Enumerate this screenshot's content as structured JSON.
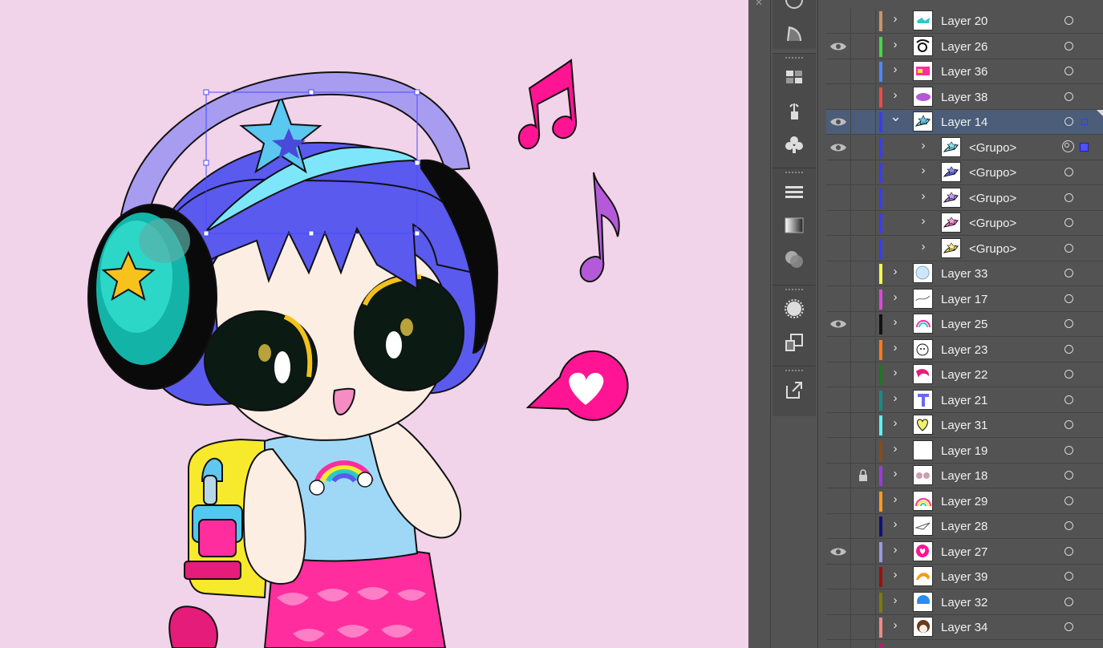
{
  "app": {
    "panel": "Layers"
  },
  "toolbar": {
    "icons": [
      "globe-icon",
      "shaper-icon",
      "swatches-icon",
      "symbol-sprayer-icon",
      "club-symbol-icon",
      "stroke-icon",
      "gradient-icon",
      "transparency-icon",
      "appearance-icon",
      "artboards-icon",
      "export-icon"
    ]
  },
  "layers": [
    {
      "name": "Layer 20",
      "color": "#c9946a",
      "visible": false,
      "locked": false,
      "expanded": false,
      "indent": 0,
      "thumb": "teal-star"
    },
    {
      "name": "Layer 26",
      "color": "#43d843",
      "visible": true,
      "locked": false,
      "expanded": false,
      "indent": 0,
      "thumb": "face"
    },
    {
      "name": "Layer 36",
      "color": "#4e86ff",
      "visible": false,
      "locked": false,
      "expanded": false,
      "indent": 0,
      "thumb": "pink-ticket"
    },
    {
      "name": "Layer 38",
      "color": "#ef4a4a",
      "visible": false,
      "locked": false,
      "expanded": false,
      "indent": 0,
      "thumb": "purple-blob"
    },
    {
      "name": "Layer 14",
      "color": "#3b3bf0",
      "visible": true,
      "locked": false,
      "expanded": true,
      "indent": 0,
      "selected": true,
      "thumb": "tiara"
    },
    {
      "name": "<Grupo>",
      "color": "#3b3bf0",
      "visible": true,
      "locked": false,
      "expanded": false,
      "indent": 1,
      "thumb": "tiara-teal",
      "targeted": true
    },
    {
      "name": "<Grupo>",
      "color": "#3b3bf0",
      "visible": false,
      "locked": false,
      "expanded": false,
      "indent": 1,
      "thumb": "tiara-blue"
    },
    {
      "name": "<Grupo>",
      "color": "#3b3bf0",
      "visible": false,
      "locked": false,
      "expanded": false,
      "indent": 1,
      "thumb": "tiara-purple"
    },
    {
      "name": "<Grupo>",
      "color": "#3b3bf0",
      "visible": false,
      "locked": false,
      "expanded": false,
      "indent": 1,
      "thumb": "tiara-pink"
    },
    {
      "name": "<Grupo>",
      "color": "#3b3bf0",
      "visible": false,
      "locked": false,
      "expanded": false,
      "indent": 1,
      "thumb": "tiara-yellow"
    },
    {
      "name": "Layer 33",
      "color": "#f6f64a",
      "visible": false,
      "locked": false,
      "expanded": false,
      "indent": 0,
      "thumb": "bubble"
    },
    {
      "name": "Layer 17",
      "color": "#e046e0",
      "visible": false,
      "locked": false,
      "expanded": false,
      "indent": 0,
      "thumb": "sketch"
    },
    {
      "name": "Layer 25",
      "color": "#111111",
      "visible": true,
      "locked": false,
      "expanded": false,
      "indent": 0,
      "thumb": "rainbow-sketch"
    },
    {
      "name": "Layer 23",
      "color": "#ff7a1a",
      "visible": false,
      "locked": false,
      "expanded": false,
      "indent": 0,
      "thumb": "bear"
    },
    {
      "name": "Layer 22",
      "color": "#1a7a1a",
      "visible": false,
      "locked": false,
      "expanded": false,
      "indent": 0,
      "thumb": "pink-hair"
    },
    {
      "name": "Layer 21",
      "color": "#178a8a",
      "visible": false,
      "locked": false,
      "expanded": false,
      "indent": 0,
      "thumb": "letter-t"
    },
    {
      "name": "Layer 31",
      "color": "#5cf2f2",
      "visible": false,
      "locked": false,
      "expanded": false,
      "indent": 0,
      "thumb": "yellow-heart"
    },
    {
      "name": "Layer 19",
      "color": "#8a4a1a",
      "visible": false,
      "locked": false,
      "expanded": false,
      "indent": 0,
      "thumb": "blank"
    },
    {
      "name": "Layer 18",
      "color": "#9a3ad6",
      "visible": false,
      "locked": true,
      "expanded": false,
      "indent": 0,
      "thumb": "glasses"
    },
    {
      "name": "Layer 29",
      "color": "#ff9a1a",
      "visible": false,
      "locked": false,
      "expanded": false,
      "indent": 0,
      "thumb": "rainbow"
    },
    {
      "name": "Layer 28",
      "color": "#10107a",
      "visible": false,
      "locked": false,
      "expanded": false,
      "indent": 0,
      "thumb": "plane-sketch"
    },
    {
      "name": "Layer 27",
      "color": "#9a9adf",
      "visible": true,
      "locked": false,
      "expanded": false,
      "indent": 0,
      "thumb": "pink-heart"
    },
    {
      "name": "Layer 39",
      "color": "#9a1010",
      "visible": false,
      "locked": false,
      "expanded": false,
      "indent": 0,
      "thumb": "orange-hair"
    },
    {
      "name": "Layer 32",
      "color": "#7a7a10",
      "visible": false,
      "locked": false,
      "expanded": false,
      "indent": 0,
      "thumb": "blue-hair"
    },
    {
      "name": "Layer 34",
      "color": "#f08a8a",
      "visible": false,
      "locked": false,
      "expanded": false,
      "indent": 0,
      "thumb": "brown-hair"
    },
    {
      "name": "",
      "color": "#d01070",
      "visible": true,
      "locked": false,
      "expanded": false,
      "indent": 0,
      "thumb": "blank",
      "partial": true
    }
  ]
}
